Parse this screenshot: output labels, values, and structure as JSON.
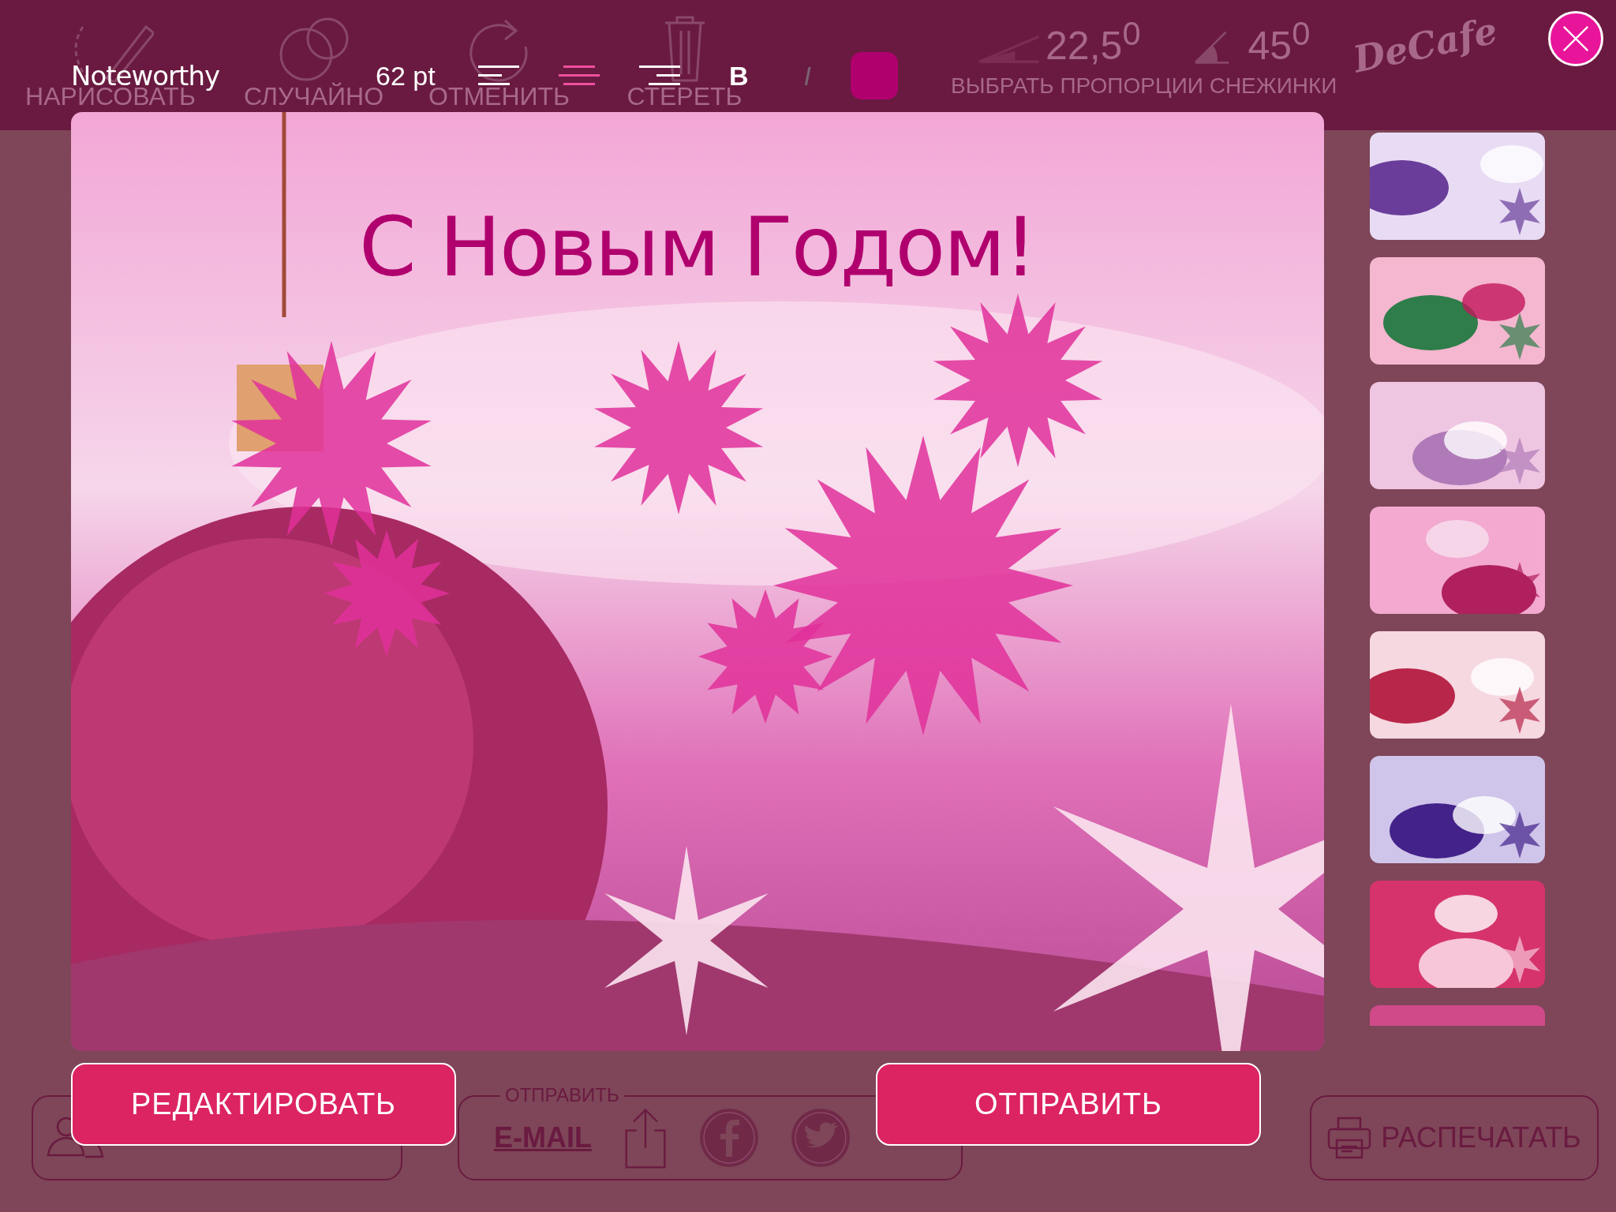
{
  "background_toolbar": {
    "tools": [
      {
        "kind": "draw",
        "label": "НАРИСОВАТЬ"
      },
      {
        "kind": "random",
        "label": "СЛУЧАЙНО"
      },
      {
        "kind": "undo",
        "label": "ОТМЕНИТЬ"
      },
      {
        "kind": "erase",
        "label": "СТЕРЕТЬ"
      }
    ],
    "angles": [
      {
        "kind": "narrow",
        "label": "22,5$^{0}$"
      },
      {
        "kind": "wide",
        "label": "45$^{0}$"
      }
    ],
    "proportions_label": "ВЫБРАТЬ ПРОПОРЦИИ СНЕЖИНКИ",
    "logo": "DeCafe"
  },
  "editor_toolbar": {
    "font": "Noteworthy",
    "size": "62 pt",
    "align_options": [
      {
        "kind": "left",
        "selected": false
      },
      {
        "kind": "center",
        "selected": true
      },
      {
        "kind": "right",
        "selected": false
      }
    ],
    "styles": [
      {
        "kind": "bold",
        "label": "B",
        "on": true
      },
      {
        "kind": "italic",
        "label": "I",
        "on": false
      }
    ]
  },
  "card": {
    "greeting": "С Новым Годом!"
  },
  "buttons": [
    {
      "label": "РЕДАКТИРОВАТЬ"
    },
    {
      "label": "ОТПРАВИТЬ"
    }
  ],
  "background_bottom": {
    "send_label": "ОТПРАВИТЬ",
    "email_link": "E-MAIL",
    "print_button": "РАСПЕЧАТАТЬ"
  }
}
